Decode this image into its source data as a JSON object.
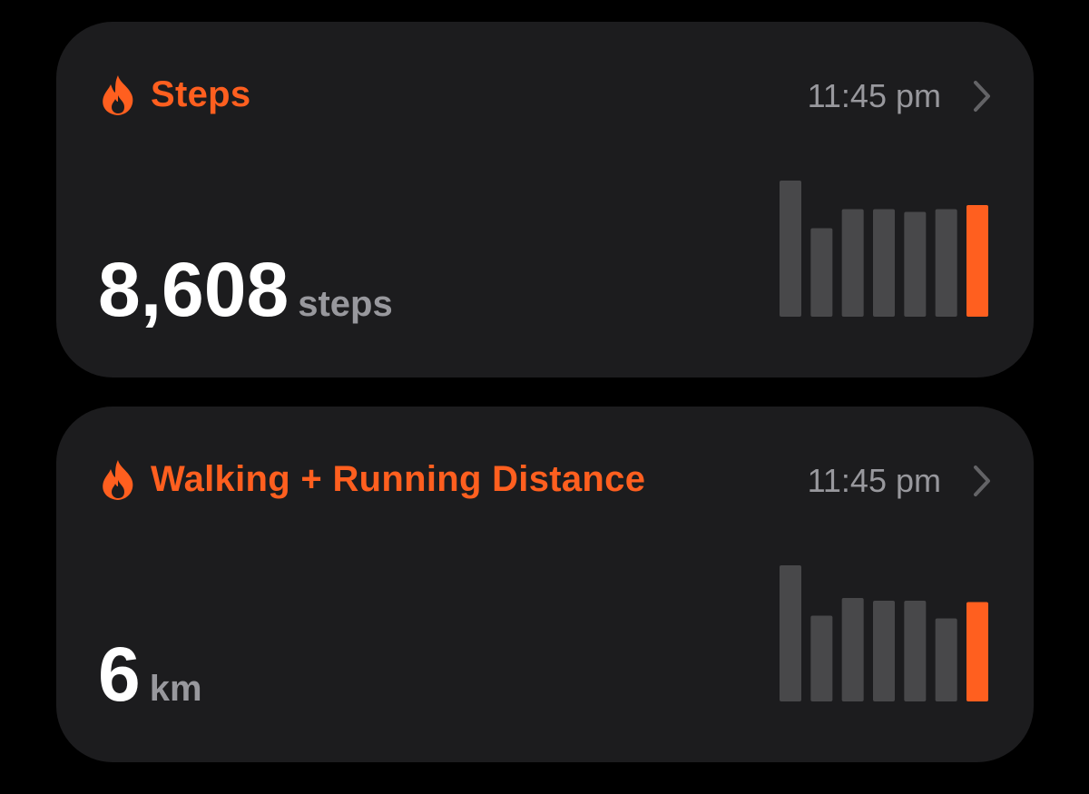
{
  "accent_color": "#ff5f1f",
  "bar_color": "#48484a",
  "cards": [
    {
      "icon": "flame-icon",
      "title": "Steps",
      "time": "11:45 pm",
      "value": "8,608",
      "unit": "steps",
      "bars": [
        1.0,
        0.65,
        0.79,
        0.79,
        0.77,
        0.79,
        0.82
      ]
    },
    {
      "icon": "flame-icon",
      "title": "Walking + Running Distance",
      "time": "11:45 pm",
      "value": "6",
      "unit": "km",
      "bars": [
        1.0,
        0.63,
        0.76,
        0.74,
        0.74,
        0.61,
        0.73
      ]
    }
  ]
}
